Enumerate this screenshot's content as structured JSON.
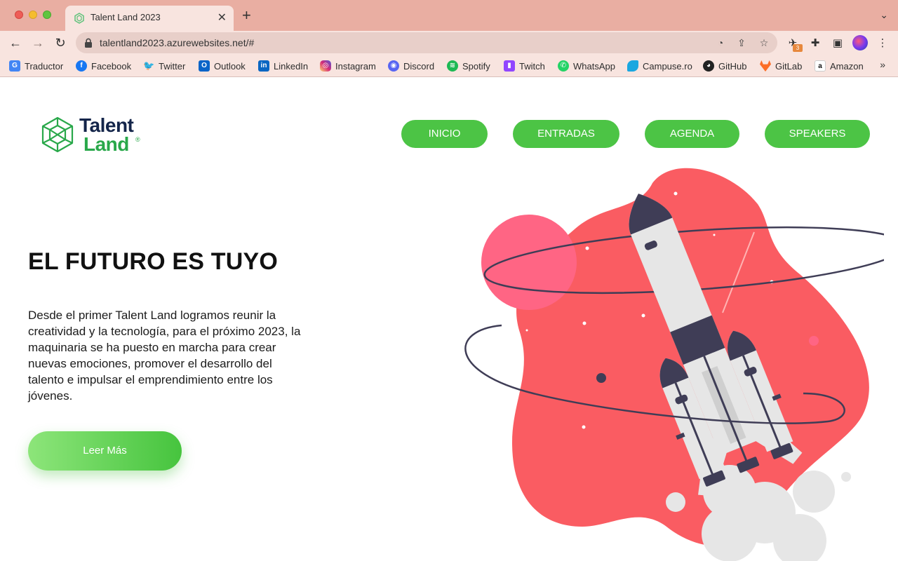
{
  "browser": {
    "tab_title": "Talent Land 2023",
    "url": "talentland2023.azurewebsites.net/#",
    "extension_badge": "3",
    "bookmarks": [
      {
        "label": "Traductor",
        "icon": "translate-icon",
        "color": "#4285f4"
      },
      {
        "label": "Facebook",
        "icon": "facebook-icon",
        "color": "#1877f2"
      },
      {
        "label": "Twitter",
        "icon": "twitter-icon",
        "color": "#1d9bf0"
      },
      {
        "label": "Outlook",
        "icon": "outlook-icon",
        "color": "#0a64c8"
      },
      {
        "label": "LinkedIn",
        "icon": "linkedin-icon",
        "color": "#0a66c2"
      },
      {
        "label": "Instagram",
        "icon": "instagram-icon",
        "color": "#d62976"
      },
      {
        "label": "Discord",
        "icon": "discord-icon",
        "color": "#5865f2"
      },
      {
        "label": "Spotify",
        "icon": "spotify-icon",
        "color": "#1db954"
      },
      {
        "label": "Twitch",
        "icon": "twitch-icon",
        "color": "#9146ff"
      },
      {
        "label": "WhatsApp",
        "icon": "whatsapp-icon",
        "color": "#25d366"
      },
      {
        "label": "Campuse.ro",
        "icon": "campusero-icon",
        "color": "#1aa7e0"
      },
      {
        "label": "GitHub",
        "icon": "github-icon",
        "color": "#222222"
      },
      {
        "label": "GitLab",
        "icon": "gitlab-icon",
        "color": "#fc6d26"
      },
      {
        "label": "Amazon",
        "icon": "amazon-icon",
        "color": "#ffffff"
      }
    ]
  },
  "site": {
    "logo": {
      "line1": "Talent",
      "line2": "Land",
      "reg": "®"
    },
    "nav": [
      {
        "label": "INICIO"
      },
      {
        "label": "ENTRADAS"
      },
      {
        "label": "AGENDA"
      },
      {
        "label": "SPEAKERS"
      }
    ],
    "hero": {
      "title": "EL FUTURO ES TUYO",
      "body": "Desde el primer Talent Land logramos reunir la creatividad y la tecnología, para el próximo 2023, la maquinaria se ha puesto en marcha para crear nuevas emociones, promover el desarrollo del talento e impulsar el emprendimiento entre los jóvenes.",
      "cta": "Leer Más"
    },
    "colors": {
      "brand_green": "#4cc445",
      "brand_navy": "#14254a",
      "blob_red": "#fa5c62",
      "planet_pink": "#ff6584",
      "rocket_dark": "#3f3d56"
    }
  }
}
